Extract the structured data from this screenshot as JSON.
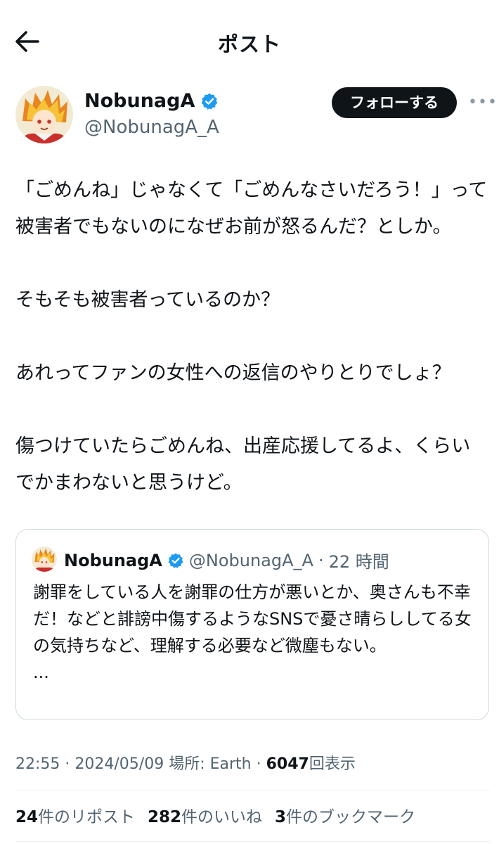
{
  "header": {
    "title": "ポスト"
  },
  "author": {
    "name": "NobunagA",
    "handle": "@NobunagA_A",
    "follow_label": "フォローする",
    "more_label": "•••"
  },
  "post": {
    "paragraphs": [
      "「ごめんね」じゃなくて「ごめんなさいだろう！」って被害者でもないのになぜお前が怒るんだ？としか。",
      "そもそも被害者っているのか？",
      "あれってファンの女性への返信のやりとりでしょ？",
      "傷つけていたらごめんね、出産応援してるよ、くらいでかまわないと思うけど。"
    ]
  },
  "quote": {
    "name": "NobunagA",
    "handle": "@NobunagA_A",
    "separator": "·",
    "time": "22 時間",
    "text": "謝罪をしている人を謝罪の仕方が悪いとか、奥さんも不幸だ！などと誹謗中傷するようなSNSで憂さ晴らししてる女の気持ちなど、理解する必要など微塵もない。",
    "ellipsis": "..."
  },
  "meta": {
    "time": "22:55",
    "sep1": "·",
    "date": "2024/05/09",
    "location_label": "場所: Earth",
    "sep2": "·",
    "views_count": "6047",
    "views_label": "回表示"
  },
  "stats": {
    "reposts_count": "24",
    "reposts_label": "件のリポスト",
    "likes_count": "282",
    "likes_label": "件のいいね",
    "bookmarks_count": "3",
    "bookmarks_label": "件のブックマーク"
  },
  "colors": {
    "text": "#0f1419",
    "secondary": "#536471",
    "verified": "#1d9bf0",
    "border": "#cfd9de",
    "button_bg": "#0f1419"
  },
  "icons": {
    "back": "arrow-left-icon",
    "verified": "verified-badge-icon",
    "more": "more-dots-icon"
  }
}
